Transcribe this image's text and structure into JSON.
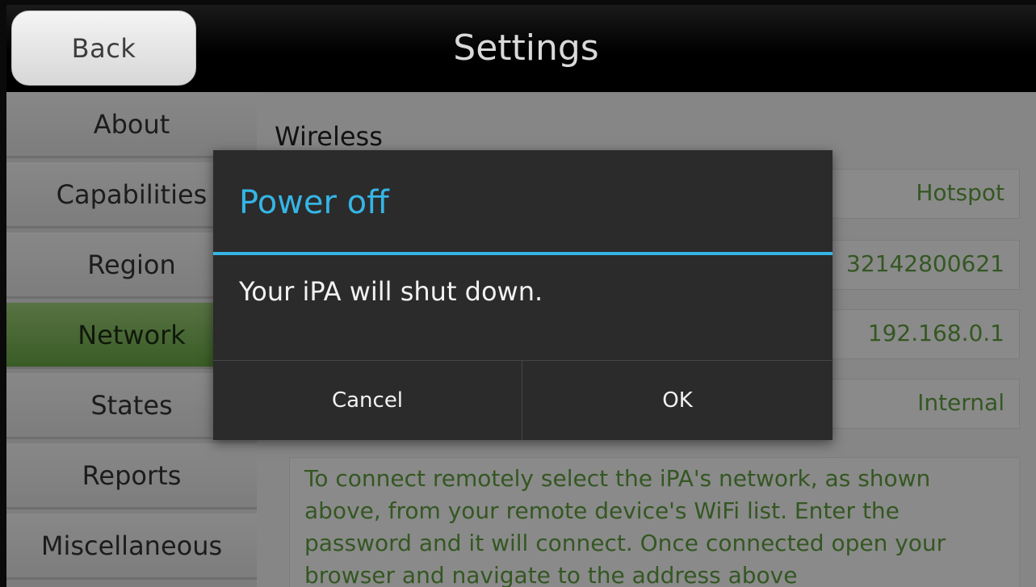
{
  "header": {
    "back_label": "Back",
    "title": "Settings"
  },
  "sidebar": {
    "items": [
      {
        "label": "About",
        "active": false
      },
      {
        "label": "Capabilities",
        "active": false
      },
      {
        "label": "Region",
        "active": false
      },
      {
        "label": "Network",
        "active": true
      },
      {
        "label": "States",
        "active": false
      },
      {
        "label": "Reports",
        "active": false
      },
      {
        "label": "Miscellaneous",
        "active": false
      }
    ],
    "active_color": "#7ab853"
  },
  "main": {
    "section_title": "Wireless",
    "rows": [
      {
        "value": "Hotspot"
      },
      {
        "value": "32142800621"
      },
      {
        "value": "192.168.0.1"
      },
      {
        "value": "Internal"
      }
    ],
    "info_text": "To connect remotely select the iPA's network, as shown above, from your remote device's WiFi list. Enter the password and it will connect. Once connected open your browser and navigate to the address above",
    "value_color": "#5f9e3e"
  },
  "dialog": {
    "title": "Power off",
    "message": "Your iPA will shut down.",
    "cancel_label": "Cancel",
    "ok_label": "OK",
    "accent_color": "#35b5e5"
  }
}
